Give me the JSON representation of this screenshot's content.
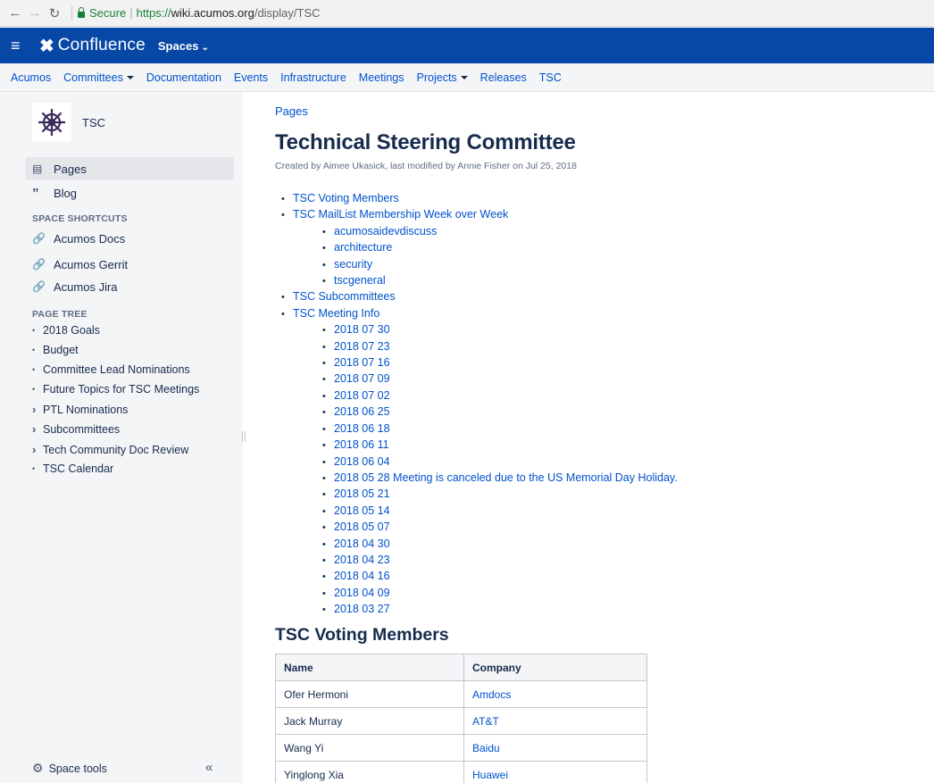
{
  "browser": {
    "secure_label": "Secure",
    "url_scheme": "https://",
    "url_host": "wiki.acumos.org",
    "url_path": "/display/TSC"
  },
  "header": {
    "logo_text": "Confluence",
    "spaces_label": "Spaces"
  },
  "space_nav": {
    "items": [
      "Acumos",
      "Committees",
      "Documentation",
      "Events",
      "Infrastructure",
      "Meetings",
      "Projects",
      "Releases",
      "TSC"
    ]
  },
  "sidebar": {
    "space_name": "TSC",
    "pages_label": "Pages",
    "blog_label": "Blog",
    "shortcuts_title": "SPACE SHORTCUTS",
    "shortcuts": [
      "Acumos Docs",
      "Acumos Gerrit",
      "Acumos Jira"
    ],
    "tree_title": "PAGE TREE",
    "tree": [
      {
        "label": "2018 Goals",
        "marker": "•"
      },
      {
        "label": "Budget",
        "marker": "•"
      },
      {
        "label": "Committee Lead Nominations",
        "marker": "•"
      },
      {
        "label": "Future Topics for TSC Meetings",
        "marker": "•"
      },
      {
        "label": "PTL Nominations",
        "marker": "›"
      },
      {
        "label": "Subcommittees",
        "marker": "›"
      },
      {
        "label": "Tech Community Doc Review",
        "marker": "›"
      },
      {
        "label": "TSC Calendar",
        "marker": "•"
      }
    ],
    "space_tools_label": "Space tools",
    "collapse_label": "«"
  },
  "main": {
    "breadcrumb": "Pages",
    "title": "Technical Steering Committee",
    "byline": "Created by Aimee Ukasick, last modified by Annie Fisher on Jul 25, 2018",
    "toc": {
      "voting_members": "TSC Voting Members",
      "maillist": "TSC MailList Membership Week over Week",
      "maillist_children": [
        "acumosaidevdiscuss",
        "architecture",
        "security",
        "tscgeneral"
      ],
      "subcommittees": "TSC Subcommittees",
      "meeting_info": "TSC Meeting Info",
      "meetings": [
        "2018 07 30",
        "2018 07 23",
        "2018 07 16",
        "2018 07 09",
        "2018 07 02",
        "2018 06 25",
        "2018 06 18",
        "2018 06 11",
        "2018 06 04",
        "2018 05 28 Meeting is canceled due to the US Memorial Day Holiday.",
        "2018 05 21",
        "2018 05 14",
        "2018 05 07",
        "2018 04 30",
        "2018 04 23",
        "2018 04 16",
        "2018 04 09",
        "2018 03 27"
      ]
    },
    "members_heading": "TSC Voting Members",
    "table": {
      "headers": [
        "Name",
        "Company"
      ],
      "rows": [
        [
          "Ofer Hermoni",
          "Amdocs"
        ],
        [
          "Jack Murray",
          "AT&T"
        ],
        [
          "Wang Yi",
          "Baidu"
        ],
        [
          "Yinglong Xia",
          "Huawei"
        ]
      ]
    }
  }
}
